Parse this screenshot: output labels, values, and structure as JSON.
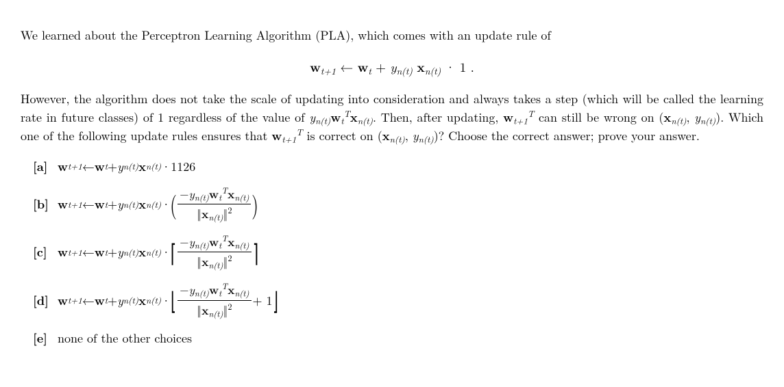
{
  "para1": "We learned about the Perceptron Learning Algorithm (PLA), which comes with an update rule of",
  "display_eq": {
    "lhs_w": "w",
    "lhs_sub": "t+1",
    "arrow": " ← ",
    "rhs_w": "w",
    "rhs_sub": "t",
    "plus": " + ",
    "y": "y",
    "y_sub": "n(t)",
    "x": "x",
    "x_sub": "n(t)",
    "dot": " · ",
    "constant": "1",
    "period": "  ."
  },
  "para2_a": "However, the algorithm does not take the scale of updating into consideration and always takes a step (which will be called the learning rate in future classes) of 1 regardless of the value of ",
  "inline1": {
    "y": "y",
    "y_sub": "n(t)",
    "wT": "w",
    "w_sub": "t",
    "w_sup": "T",
    "x": "x",
    "x_sub": "n(t)"
  },
  "para2_b": ". Then, after updating, ",
  "inline2": {
    "w": "w",
    "w_sub": "t+1",
    "w_sup": "T"
  },
  "para2_c": " can still be wrong on ",
  "inline3": {
    "open": "(",
    "x": "x",
    "x_sub": "n(t)",
    "comma": ", ",
    "y": "y",
    "y_sub": "n(t)",
    "close": ")"
  },
  "para2_d": ". Which one of the following update rules ensures that ",
  "inline4": {
    "w": "w",
    "w_sub": "t+1",
    "w_sup": "T"
  },
  "para2_e": " is correct on ",
  "inline5": {
    "open": "(",
    "x": "x",
    "x_sub": "n(t)",
    "comma": ", ",
    "y": "y",
    "y_sub": "n(t)",
    "close": ")"
  },
  "para2_f": "? Choose the correct answer; prove your answer.",
  "common_update": {
    "w": "w",
    "sub_tp1": "t+1",
    "arrow": " ← ",
    "sub_t": "t",
    "plus": " + ",
    "y": "y",
    "y_sub": "n(t)",
    "x": "x",
    "x_sub": "n(t)",
    "dot": " · "
  },
  "frac_common": {
    "neg": "−",
    "y": "y",
    "y_sub": "n(t)",
    "w": "w",
    "w_sub": "t",
    "w_sup": "T",
    "x": "x",
    "x_sub": "n(t)",
    "norm_open": "‖",
    "norm_close": "‖",
    "sq": "2"
  },
  "choices": {
    "a": {
      "label": "[a]",
      "constant": "1126"
    },
    "b": {
      "label": "[b]"
    },
    "c": {
      "label": "[c]"
    },
    "d": {
      "label": "[d]",
      "plus1": " + 1"
    },
    "e": {
      "label": "[e]",
      "text": "none of the other choices"
    }
  }
}
